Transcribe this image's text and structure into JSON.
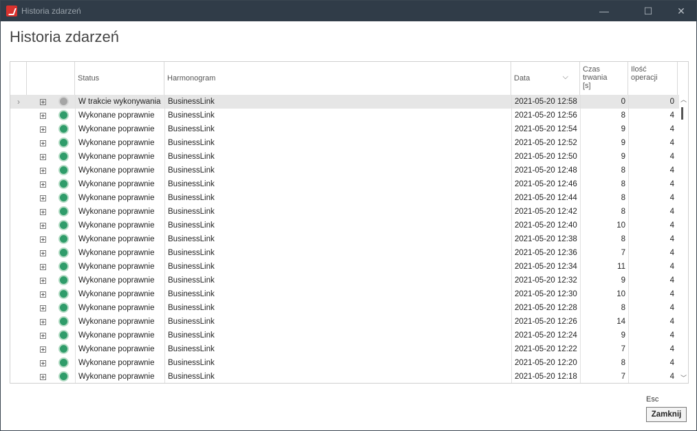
{
  "window": {
    "title": "Historia zdarzeń",
    "minimize": "—",
    "maximize": "☐",
    "close": "✕"
  },
  "page": {
    "title": "Historia zdarzeń"
  },
  "grid": {
    "columns": {
      "status": "Status",
      "harmonogram": "Harmonogram",
      "data": "Data",
      "czas": "Czas\ntrwania\n[s]",
      "ilosc": "Ilość\noperacji"
    },
    "sort_icon": "⌵",
    "rows": [
      {
        "status": "W trakcie wykonywania",
        "harmonogram": "BusinessLink",
        "data": "2021-05-20 12:58",
        "czas": "0",
        "ilosc": "0",
        "state": "running"
      },
      {
        "status": "Wykonane poprawnie",
        "harmonogram": "BusinessLink",
        "data": "2021-05-20 12:56",
        "czas": "8",
        "ilosc": "4",
        "state": "ok"
      },
      {
        "status": "Wykonane poprawnie",
        "harmonogram": "BusinessLink",
        "data": "2021-05-20 12:54",
        "czas": "9",
        "ilosc": "4",
        "state": "ok"
      },
      {
        "status": "Wykonane poprawnie",
        "harmonogram": "BusinessLink",
        "data": "2021-05-20 12:52",
        "czas": "9",
        "ilosc": "4",
        "state": "ok"
      },
      {
        "status": "Wykonane poprawnie",
        "harmonogram": "BusinessLink",
        "data": "2021-05-20 12:50",
        "czas": "9",
        "ilosc": "4",
        "state": "ok"
      },
      {
        "status": "Wykonane poprawnie",
        "harmonogram": "BusinessLink",
        "data": "2021-05-20 12:48",
        "czas": "8",
        "ilosc": "4",
        "state": "ok"
      },
      {
        "status": "Wykonane poprawnie",
        "harmonogram": "BusinessLink",
        "data": "2021-05-20 12:46",
        "czas": "8",
        "ilosc": "4",
        "state": "ok"
      },
      {
        "status": "Wykonane poprawnie",
        "harmonogram": "BusinessLink",
        "data": "2021-05-20 12:44",
        "czas": "8",
        "ilosc": "4",
        "state": "ok"
      },
      {
        "status": "Wykonane poprawnie",
        "harmonogram": "BusinessLink",
        "data": "2021-05-20 12:42",
        "czas": "8",
        "ilosc": "4",
        "state": "ok"
      },
      {
        "status": "Wykonane poprawnie",
        "harmonogram": "BusinessLink",
        "data": "2021-05-20 12:40",
        "czas": "10",
        "ilosc": "4",
        "state": "ok"
      },
      {
        "status": "Wykonane poprawnie",
        "harmonogram": "BusinessLink",
        "data": "2021-05-20 12:38",
        "czas": "8",
        "ilosc": "4",
        "state": "ok"
      },
      {
        "status": "Wykonane poprawnie",
        "harmonogram": "BusinessLink",
        "data": "2021-05-20 12:36",
        "czas": "7",
        "ilosc": "4",
        "state": "ok"
      },
      {
        "status": "Wykonane poprawnie",
        "harmonogram": "BusinessLink",
        "data": "2021-05-20 12:34",
        "czas": "11",
        "ilosc": "4",
        "state": "ok"
      },
      {
        "status": "Wykonane poprawnie",
        "harmonogram": "BusinessLink",
        "data": "2021-05-20 12:32",
        "czas": "9",
        "ilosc": "4",
        "state": "ok"
      },
      {
        "status": "Wykonane poprawnie",
        "harmonogram": "BusinessLink",
        "data": "2021-05-20 12:30",
        "czas": "10",
        "ilosc": "4",
        "state": "ok"
      },
      {
        "status": "Wykonane poprawnie",
        "harmonogram": "BusinessLink",
        "data": "2021-05-20 12:28",
        "czas": "8",
        "ilosc": "4",
        "state": "ok"
      },
      {
        "status": "Wykonane poprawnie",
        "harmonogram": "BusinessLink",
        "data": "2021-05-20 12:26",
        "czas": "14",
        "ilosc": "4",
        "state": "ok"
      },
      {
        "status": "Wykonane poprawnie",
        "harmonogram": "BusinessLink",
        "data": "2021-05-20 12:24",
        "czas": "9",
        "ilosc": "4",
        "state": "ok"
      },
      {
        "status": "Wykonane poprawnie",
        "harmonogram": "BusinessLink",
        "data": "2021-05-20 12:22",
        "czas": "7",
        "ilosc": "4",
        "state": "ok"
      },
      {
        "status": "Wykonane poprawnie",
        "harmonogram": "BusinessLink",
        "data": "2021-05-20 12:20",
        "czas": "8",
        "ilosc": "4",
        "state": "ok"
      },
      {
        "status": "Wykonane poprawnie",
        "harmonogram": "BusinessLink",
        "data": "2021-05-20 12:18",
        "czas": "7",
        "ilosc": "4",
        "state": "ok"
      }
    ],
    "row_indicator": "›",
    "scroll_up": "︿",
    "scroll_down": "﹀"
  },
  "footer": {
    "esc_hint": "Esc",
    "close_label": "Zamknij"
  },
  "colors": {
    "titlebar": "#303c48",
    "ok_status": "#2f9c6a",
    "running_status": "#a5a5a5",
    "selected_row": "#e6e6e6"
  }
}
